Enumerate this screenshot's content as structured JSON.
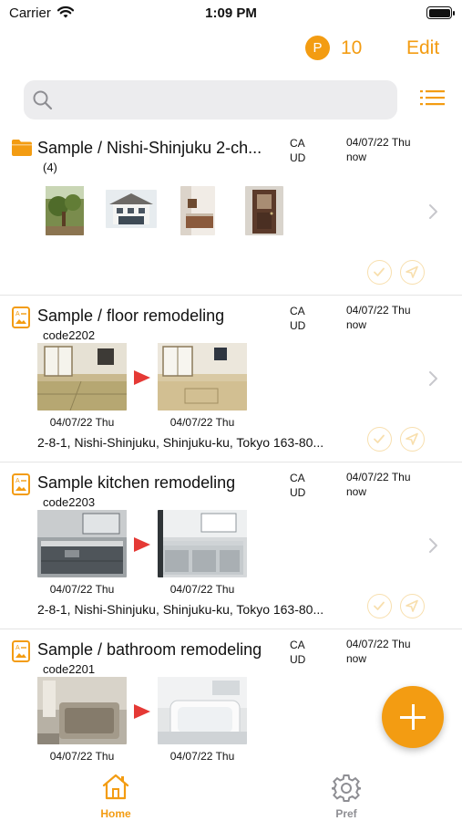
{
  "status_bar": {
    "carrier": "Carrier",
    "time": "1:09 PM"
  },
  "header": {
    "points_badge": "P",
    "points": "10",
    "edit_label": "Edit"
  },
  "search": {
    "placeholder": ""
  },
  "items": [
    {
      "type": "folder",
      "title": "Sample / Nishi-Shinjuku 2-ch...",
      "subtitle": "(4)",
      "tag1": "CA",
      "tag2": "UD",
      "date": "04/07/22 Thu",
      "updated": "now"
    },
    {
      "type": "album",
      "title": "Sample / floor remodeling",
      "subtitle": "code2202",
      "tag1": "CA",
      "tag2": "UD",
      "date": "04/07/22 Thu",
      "updated": "now",
      "before_date": "04/07/22 Thu",
      "after_date": "04/07/22 Thu",
      "address": "2-8-1, Nishi-Shinjuku, Shinjuku-ku, Tokyo 163-80..."
    },
    {
      "type": "album",
      "title": "Sample kitchen remodeling",
      "subtitle": "code2203",
      "tag1": "CA",
      "tag2": "UD",
      "date": "04/07/22 Thu",
      "updated": "now",
      "before_date": "04/07/22 Thu",
      "after_date": "04/07/22 Thu",
      "address": "2-8-1, Nishi-Shinjuku, Shinjuku-ku, Tokyo 163-80..."
    },
    {
      "type": "album",
      "title": "Sample / bathroom remodeling",
      "subtitle": "code2201",
      "tag1": "CA",
      "tag2": "UD",
      "date": "04/07/22 Thu",
      "updated": "now",
      "before_date": "04/07/22 Thu",
      "after_date": "04/07/22 Thu"
    }
  ],
  "tabs": [
    {
      "label": "Home",
      "active": true
    },
    {
      "label": "Pref",
      "active": false
    }
  ],
  "colors": {
    "accent": "#f39c12",
    "arrow": "#e53935",
    "inactive": "#8e8e93",
    "action_ring": "#f8dfae"
  },
  "icons": [
    "wifi-icon",
    "points-icon",
    "search-icon",
    "list-view-icon",
    "folder-icon",
    "album-icon",
    "chevron-right-icon",
    "check-icon",
    "send-icon",
    "plus-icon",
    "home-icon",
    "gear-icon"
  ]
}
